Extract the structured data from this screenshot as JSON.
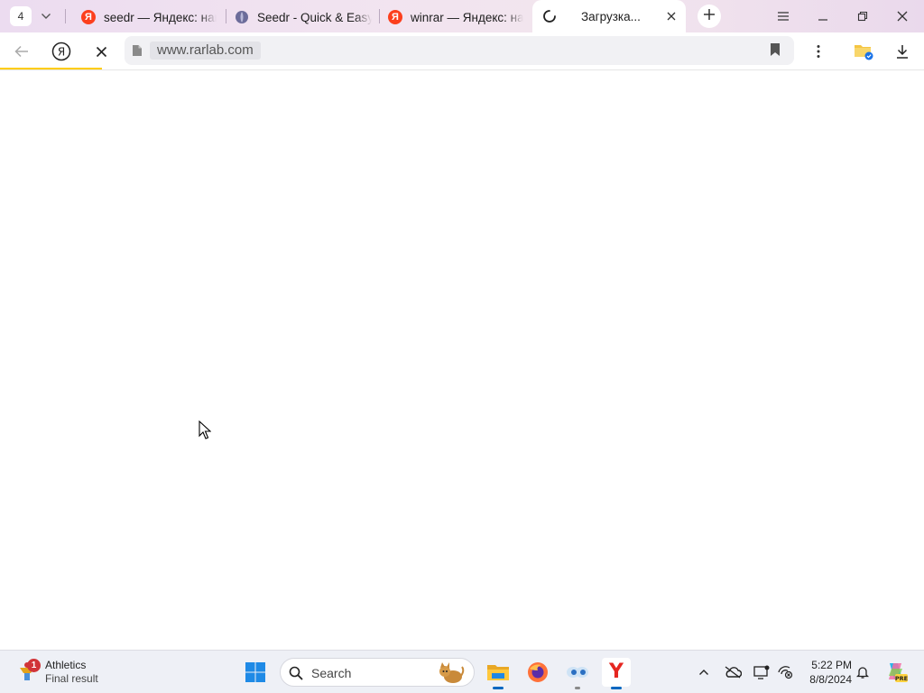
{
  "browser": {
    "tab_count": "4",
    "tabs": [
      {
        "title": "seedr — Яндекс: наш",
        "favicon": "yandex-icon"
      },
      {
        "title": "Seedr - Quick & Easy",
        "favicon": "seedr-icon"
      },
      {
        "title": "winrar — Яндекс: наш",
        "favicon": "yandex-icon"
      },
      {
        "title": "Загрузка...",
        "favicon": "loading-spinner-icon",
        "active": true
      }
    ],
    "favicon_letter": "Я",
    "address": {
      "url": "www.rarlab.com"
    },
    "loading_progress": 0.11,
    "colors": {
      "accent": "#ffcc00",
      "yandex_red": "#fc3f1d",
      "tabstrip": "#efe0ef"
    }
  },
  "taskbar": {
    "widget": {
      "title": "Athletics",
      "subtitle": "Final result",
      "badge": "1"
    },
    "search": {
      "label": "Search"
    },
    "clock": {
      "time": "5:22 PM",
      "date": "8/8/2024"
    },
    "copilot_badge": "PRE",
    "yandex_letter": "Y",
    "apps": [
      "start-icon",
      "file-explorer-icon",
      "firefox-icon",
      "eyes-app-icon",
      "yandex-browser-icon"
    ],
    "tray_icons": [
      "chevron-up-icon",
      "onedrive-icon",
      "display-icon",
      "network-icon",
      "notification-icon",
      "copilot-icon"
    ]
  }
}
